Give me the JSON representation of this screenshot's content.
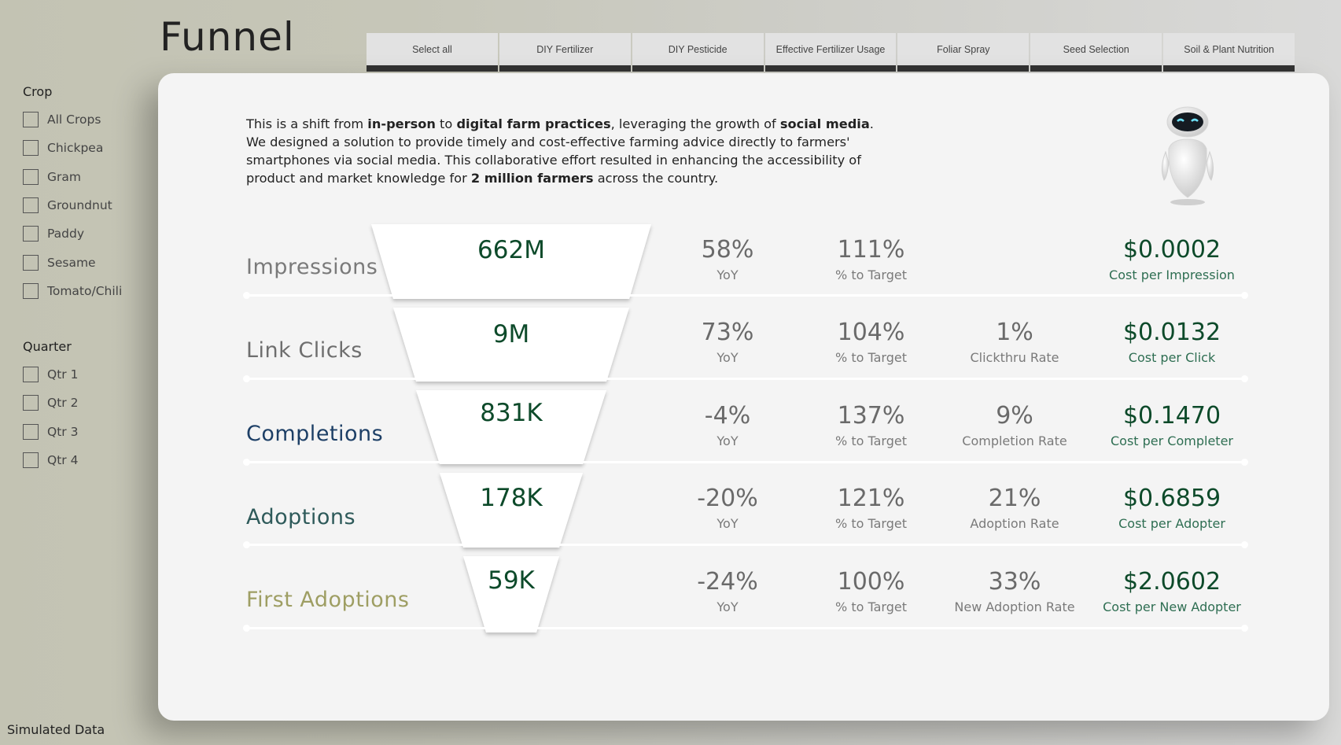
{
  "page_title": "Funnel",
  "tabs": [
    "Select all",
    "DIY Fertilizer",
    "DIY Pesticide",
    "Effective Fertilizer Usage",
    "Foliar Spray",
    "Seed Selection",
    "Soil & Plant Nutrition"
  ],
  "crop_slicer": {
    "title": "Crop",
    "items": [
      "All Crops",
      "Chickpea",
      "Gram",
      "Groundnut",
      "Paddy",
      "Sesame",
      "Tomato/Chili"
    ]
  },
  "quarter_slicer": {
    "title": "Quarter",
    "items": [
      "Qtr 1",
      "Qtr 2",
      "Qtr 3",
      "Qtr 4"
    ]
  },
  "footnote": "Simulated Data",
  "intro": {
    "p1": "This is a shift from ",
    "b1": "in-person",
    "p2": " to ",
    "b2": "digital farm practices",
    "p3": ", leveraging the growth of ",
    "b3": "social media",
    "p4": ". We designed a solution to provide timely and cost-effective farming advice directly to farmers' smartphones via social media. This collaborative effort resulted in enhancing the accessibility of product and market knowledge for ",
    "b4": "2 million farmers",
    "p5": " across the country."
  },
  "robot_icon": "robot-mascot-icon",
  "colors": {
    "impressions": "#7a7a7a",
    "link_clicks": "#6e6e6e",
    "completions": "#1d3f66",
    "adoptions": "#2e5a5a",
    "first_adoptions": "#9e9e63",
    "value_green": "#0d4a2a"
  },
  "stages": [
    {
      "name": "Impressions",
      "value": "662M",
      "yoy": "58%",
      "yoy_label": "YoY",
      "target": "111%",
      "target_label": "% to Target",
      "rate": "",
      "rate_label": "",
      "cost": "$0.0002",
      "cost_label": "Cost per Impression"
    },
    {
      "name": "Link Clicks",
      "value": "9M",
      "yoy": "73%",
      "yoy_label": "YoY",
      "target": "104%",
      "target_label": "% to Target",
      "rate": "1%",
      "rate_label": "Clickthru Rate",
      "cost": "$0.0132",
      "cost_label": "Cost per Click"
    },
    {
      "name": "Completions",
      "value": "831K",
      "yoy": "-4%",
      "yoy_label": "YoY",
      "target": "137%",
      "target_label": "% to Target",
      "rate": "9%",
      "rate_label": "Completion Rate",
      "cost": "$0.1470",
      "cost_label": "Cost per Completer"
    },
    {
      "name": "Adoptions",
      "value": "178K",
      "yoy": "-20%",
      "yoy_label": "YoY",
      "target": "121%",
      "target_label": "% to Target",
      "rate": "21%",
      "rate_label": "Adoption Rate",
      "cost": "$0.6859",
      "cost_label": "Cost per Adopter"
    },
    {
      "name": "First Adoptions",
      "value": "59K",
      "yoy": "-24%",
      "yoy_label": "YoY",
      "target": "100%",
      "target_label": "% to Target",
      "rate": "33%",
      "rate_label": "New Adoption Rate",
      "cost": "$2.0602",
      "cost_label": "Cost per New Adopter"
    }
  ]
}
